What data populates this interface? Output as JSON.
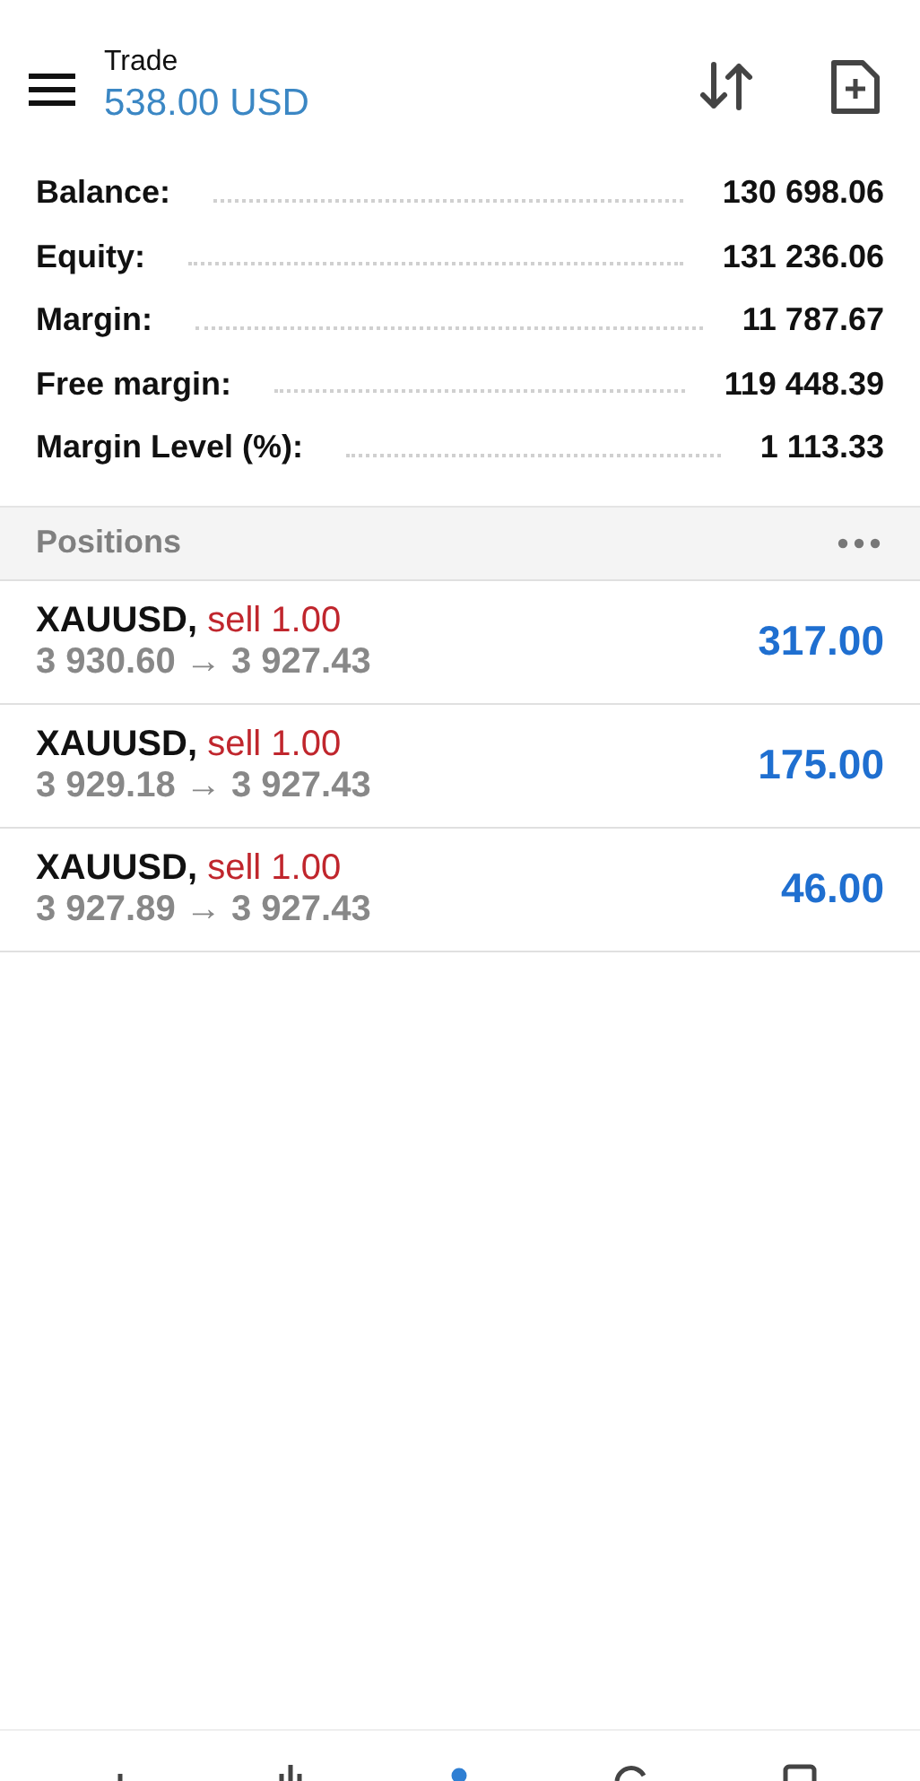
{
  "header": {
    "title": "Trade",
    "amount": "538.00 USD"
  },
  "summary": [
    {
      "label": "Balance:",
      "value": "130 698.06"
    },
    {
      "label": "Equity:",
      "value": "131 236.06"
    },
    {
      "label": "Margin:",
      "value": "11 787.67"
    },
    {
      "label": "Free margin:",
      "value": "119 448.39"
    },
    {
      "label": "Margin Level (%):",
      "value": "1 113.33"
    }
  ],
  "positions_header": {
    "title": "Positions"
  },
  "positions": [
    {
      "symbol": "XAUUSD,",
      "kind": "sell",
      "order": "sell 1.00",
      "prices": "3 930.60 → 3 927.43",
      "profit": "317.00"
    },
    {
      "symbol": "XAUUSD,",
      "kind": "sell",
      "order": "sell 1.00",
      "prices": "3 929.18 → 3 927.43",
      "profit": "175.00"
    },
    {
      "symbol": "XAUUSD,",
      "kind": "sell",
      "order": "sell 1.00",
      "prices": "3 927.89 → 3 927.43",
      "profit": "46.00"
    }
  ],
  "nav": [
    {
      "kind": "quotes",
      "selected": false
    },
    {
      "kind": "chart",
      "selected": false
    },
    {
      "kind": "trade",
      "selected": true
    },
    {
      "kind": "history",
      "selected": false
    },
    {
      "kind": "messages",
      "selected": false
    }
  ]
}
